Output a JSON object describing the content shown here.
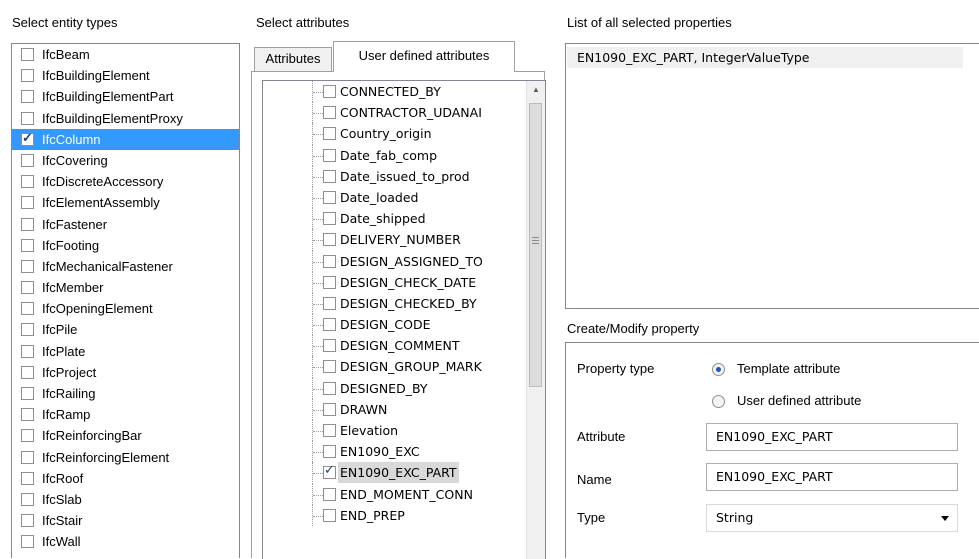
{
  "entity_panel": {
    "title": "Select entity types",
    "items": [
      {
        "label": "IfcBeam",
        "checked": false,
        "selected": false
      },
      {
        "label": "IfcBuildingElement",
        "checked": false,
        "selected": false
      },
      {
        "label": "IfcBuildingElementPart",
        "checked": false,
        "selected": false
      },
      {
        "label": "IfcBuildingElementProxy",
        "checked": false,
        "selected": false
      },
      {
        "label": "IfcColumn",
        "checked": true,
        "selected": true
      },
      {
        "label": "IfcCovering",
        "checked": false,
        "selected": false
      },
      {
        "label": "IfcDiscreteAccessory",
        "checked": false,
        "selected": false
      },
      {
        "label": "IfcElementAssembly",
        "checked": false,
        "selected": false
      },
      {
        "label": "IfcFastener",
        "checked": false,
        "selected": false
      },
      {
        "label": "IfcFooting",
        "checked": false,
        "selected": false
      },
      {
        "label": "IfcMechanicalFastener",
        "checked": false,
        "selected": false
      },
      {
        "label": "IfcMember",
        "checked": false,
        "selected": false
      },
      {
        "label": "IfcOpeningElement",
        "checked": false,
        "selected": false
      },
      {
        "label": "IfcPile",
        "checked": false,
        "selected": false
      },
      {
        "label": "IfcPlate",
        "checked": false,
        "selected": false
      },
      {
        "label": "IfcProject",
        "checked": false,
        "selected": false
      },
      {
        "label": "IfcRailing",
        "checked": false,
        "selected": false
      },
      {
        "label": "IfcRamp",
        "checked": false,
        "selected": false
      },
      {
        "label": "IfcReinforcingBar",
        "checked": false,
        "selected": false
      },
      {
        "label": "IfcReinforcingElement",
        "checked": false,
        "selected": false
      },
      {
        "label": "IfcRoof",
        "checked": false,
        "selected": false
      },
      {
        "label": "IfcSlab",
        "checked": false,
        "selected": false
      },
      {
        "label": "IfcStair",
        "checked": false,
        "selected": false
      },
      {
        "label": "IfcWall",
        "checked": false,
        "selected": false
      }
    ]
  },
  "attributes_panel": {
    "title": "Select attributes",
    "tabs": [
      {
        "label": "Attributes",
        "active": false
      },
      {
        "label": "User defined attributes",
        "active": true
      }
    ],
    "items": [
      {
        "label": "CONNECTED_BY",
        "checked": false,
        "selected": false
      },
      {
        "label": "CONTRACTOR_UDANAI",
        "checked": false,
        "selected": false
      },
      {
        "label": "Country_origin",
        "checked": false,
        "selected": false
      },
      {
        "label": "Date_fab_comp",
        "checked": false,
        "selected": false
      },
      {
        "label": "Date_issued_to_prod",
        "checked": false,
        "selected": false
      },
      {
        "label": "Date_loaded",
        "checked": false,
        "selected": false
      },
      {
        "label": "Date_shipped",
        "checked": false,
        "selected": false
      },
      {
        "label": "DELIVERY_NUMBER",
        "checked": false,
        "selected": false
      },
      {
        "label": "DESIGN_ASSIGNED_TO",
        "checked": false,
        "selected": false
      },
      {
        "label": "DESIGN_CHECK_DATE",
        "checked": false,
        "selected": false
      },
      {
        "label": "DESIGN_CHECKED_BY",
        "checked": false,
        "selected": false
      },
      {
        "label": "DESIGN_CODE",
        "checked": false,
        "selected": false
      },
      {
        "label": "DESIGN_COMMENT",
        "checked": false,
        "selected": false
      },
      {
        "label": "DESIGN_GROUP_MARK",
        "checked": false,
        "selected": false
      },
      {
        "label": "DESIGNED_BY",
        "checked": false,
        "selected": false
      },
      {
        "label": "DRAWN",
        "checked": false,
        "selected": false
      },
      {
        "label": "Elevation",
        "checked": false,
        "selected": false
      },
      {
        "label": "EN1090_EXC",
        "checked": false,
        "selected": false
      },
      {
        "label": "EN1090_EXC_PART",
        "checked": true,
        "selected": true
      },
      {
        "label": "END_MOMENT_CONN",
        "checked": false,
        "selected": false
      },
      {
        "label": "END_PREP",
        "checked": false,
        "selected": false
      }
    ]
  },
  "properties_panel": {
    "title": "List of all selected properties",
    "items": [
      "EN1090_EXC_PART,  IntegerValueType"
    ]
  },
  "modify_panel": {
    "title": "Create/Modify property",
    "property_type_label": "Property type",
    "radio_template": {
      "label": "Template attribute",
      "checked": true
    },
    "radio_user_defined": {
      "label": "User defined attribute",
      "checked": false
    },
    "attribute_label": "Attribute",
    "attribute_value": "EN1090_EXC_PART",
    "name_label": "Name",
    "name_value": "EN1090_EXC_PART",
    "type_label": "Type",
    "type_value": "String"
  },
  "icons": {
    "checkbox_tick": "✓",
    "scroll_up": "▲"
  }
}
